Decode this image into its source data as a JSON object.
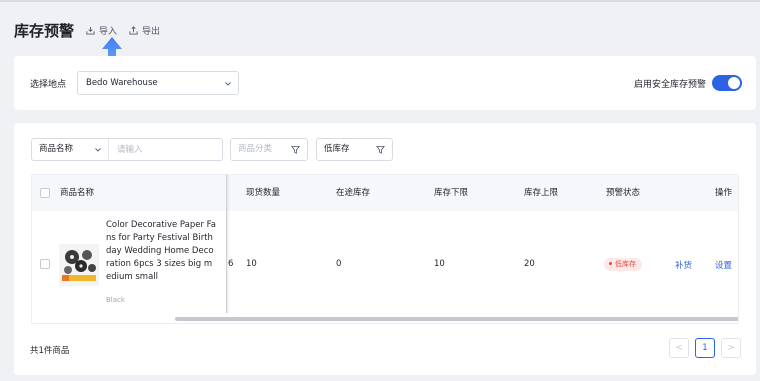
{
  "header": {
    "title": "库存预警",
    "import_label": "导入",
    "export_label": "导出"
  },
  "location": {
    "label": "选择地点",
    "value": "Bedo Warehouse"
  },
  "safety_toggle": {
    "label": "启用安全库存预警",
    "enabled": true
  },
  "filters": {
    "field_select": "商品名称",
    "search_placeholder": "请输入",
    "category_placeholder": "商品分类",
    "stock_filter": "低库存"
  },
  "table": {
    "columns": {
      "name": "商品名称",
      "on_hand": "现货数量",
      "in_transit": "在途库存",
      "min": "库存下限",
      "max": "库存上限",
      "status": "预警状态",
      "actions": "操作"
    },
    "rows": [
      {
        "title": "Color Decorative Paper Fans for Party Festival Birthday Wedding Home Decoration 6pcs 3 sizes big medium small",
        "variant": "Black",
        "partial_value": "6",
        "on_hand": "10",
        "in_transit": "0",
        "min": "10",
        "max": "20",
        "status": "低库存",
        "action_restock": "补货",
        "action_settings": "设置"
      }
    ]
  },
  "footer": {
    "count_text": "共1件商品",
    "page_prev": "<",
    "page_current": "1",
    "page_next": ">"
  },
  "colors": {
    "accent": "#2c63e3",
    "danger": "#e14d3f",
    "background": "#f0f1f5"
  }
}
